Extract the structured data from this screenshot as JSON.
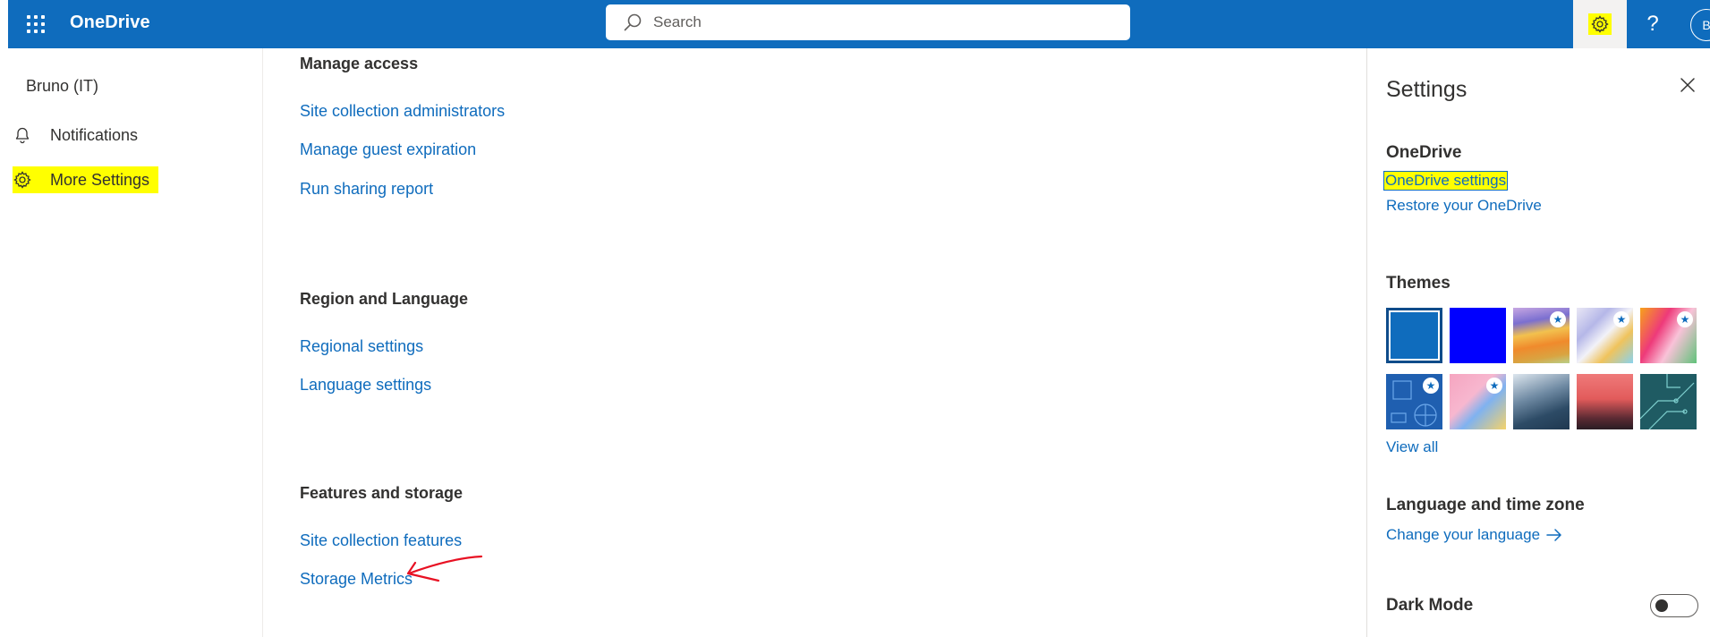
{
  "header": {
    "app_name": "OneDrive",
    "search_placeholder": "Search",
    "help_label": "?",
    "avatar_initial": "B",
    "brand_color": "#0f6cbd"
  },
  "leftnav": {
    "user": "Bruno (IT)",
    "items": [
      {
        "label": "Notifications",
        "icon": "bell-icon"
      },
      {
        "label": "More Settings",
        "icon": "gear-icon"
      }
    ]
  },
  "main": {
    "sections": [
      {
        "title": "Manage access",
        "links": [
          "Site collection administrators",
          "Manage guest expiration",
          "Run sharing report"
        ]
      },
      {
        "title": "Region and Language",
        "links": [
          "Regional settings",
          "Language settings"
        ]
      },
      {
        "title": "Features and storage",
        "links": [
          "Site collection features",
          "Storage Metrics"
        ]
      }
    ]
  },
  "panel": {
    "title": "Settings",
    "onedrive": {
      "heading": "OneDrive",
      "settings_link": "OneDrive settings",
      "restore_link": "Restore your OneDrive"
    },
    "themes": {
      "heading": "Themes",
      "view_all": "View all",
      "selected": "blue"
    },
    "language": {
      "heading": "Language and time zone",
      "link": "Change your language"
    },
    "dark_mode": {
      "heading": "Dark Mode",
      "enabled": false
    }
  },
  "colors": {
    "highlight": "#ffff00",
    "link": "#0f6cbd",
    "annotation_arrow": "#e81123"
  }
}
